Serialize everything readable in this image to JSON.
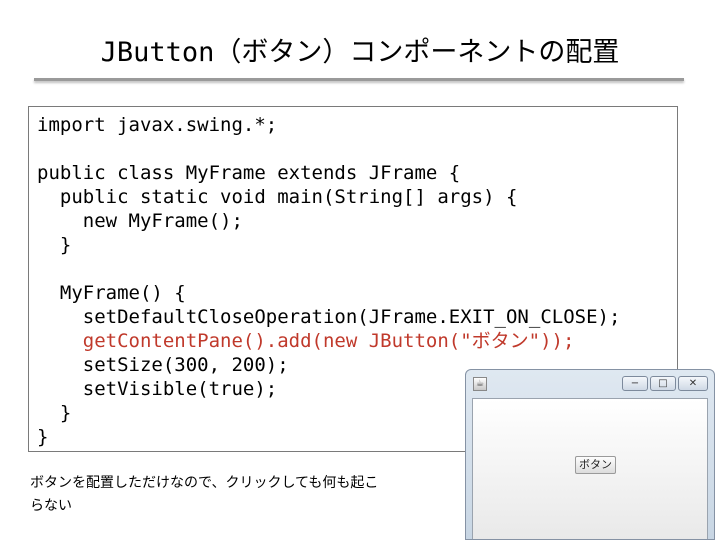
{
  "slide": {
    "title": "JButton（ボタン）コンポーネントの配置",
    "code_lines": [
      {
        "text": "import javax.swing.*;",
        "highlight": false
      },
      {
        "text": "",
        "highlight": false
      },
      {
        "text": "public class MyFrame extends JFrame {",
        "highlight": false
      },
      {
        "text": "  public static void main(String[] args) {",
        "highlight": false
      },
      {
        "text": "    new MyFrame();",
        "highlight": false
      },
      {
        "text": "  }",
        "highlight": false
      },
      {
        "text": "",
        "highlight": false
      },
      {
        "text": "  MyFrame() {",
        "highlight": false
      },
      {
        "text": "    setDefaultCloseOperation(JFrame.EXIT_ON_CLOSE);",
        "highlight": false
      },
      {
        "text": "    getContentPane().add(new JButton(\"ボタン\"));",
        "highlight": true
      },
      {
        "text": "    setSize(300, 200);",
        "highlight": false
      },
      {
        "text": "    setVisible(true);",
        "highlight": false
      },
      {
        "text": "  }",
        "highlight": false
      },
      {
        "text": "}",
        "highlight": false
      }
    ],
    "caption_lines": [
      "ボタンを配置しただけなので、クリックしても何も起こ",
      "らない"
    ],
    "highlight_color": "#c0392b"
  },
  "window": {
    "minimize_glyph": "−",
    "maximize_glyph": "□",
    "close_glyph": "✕",
    "button_label": "ボタン"
  }
}
